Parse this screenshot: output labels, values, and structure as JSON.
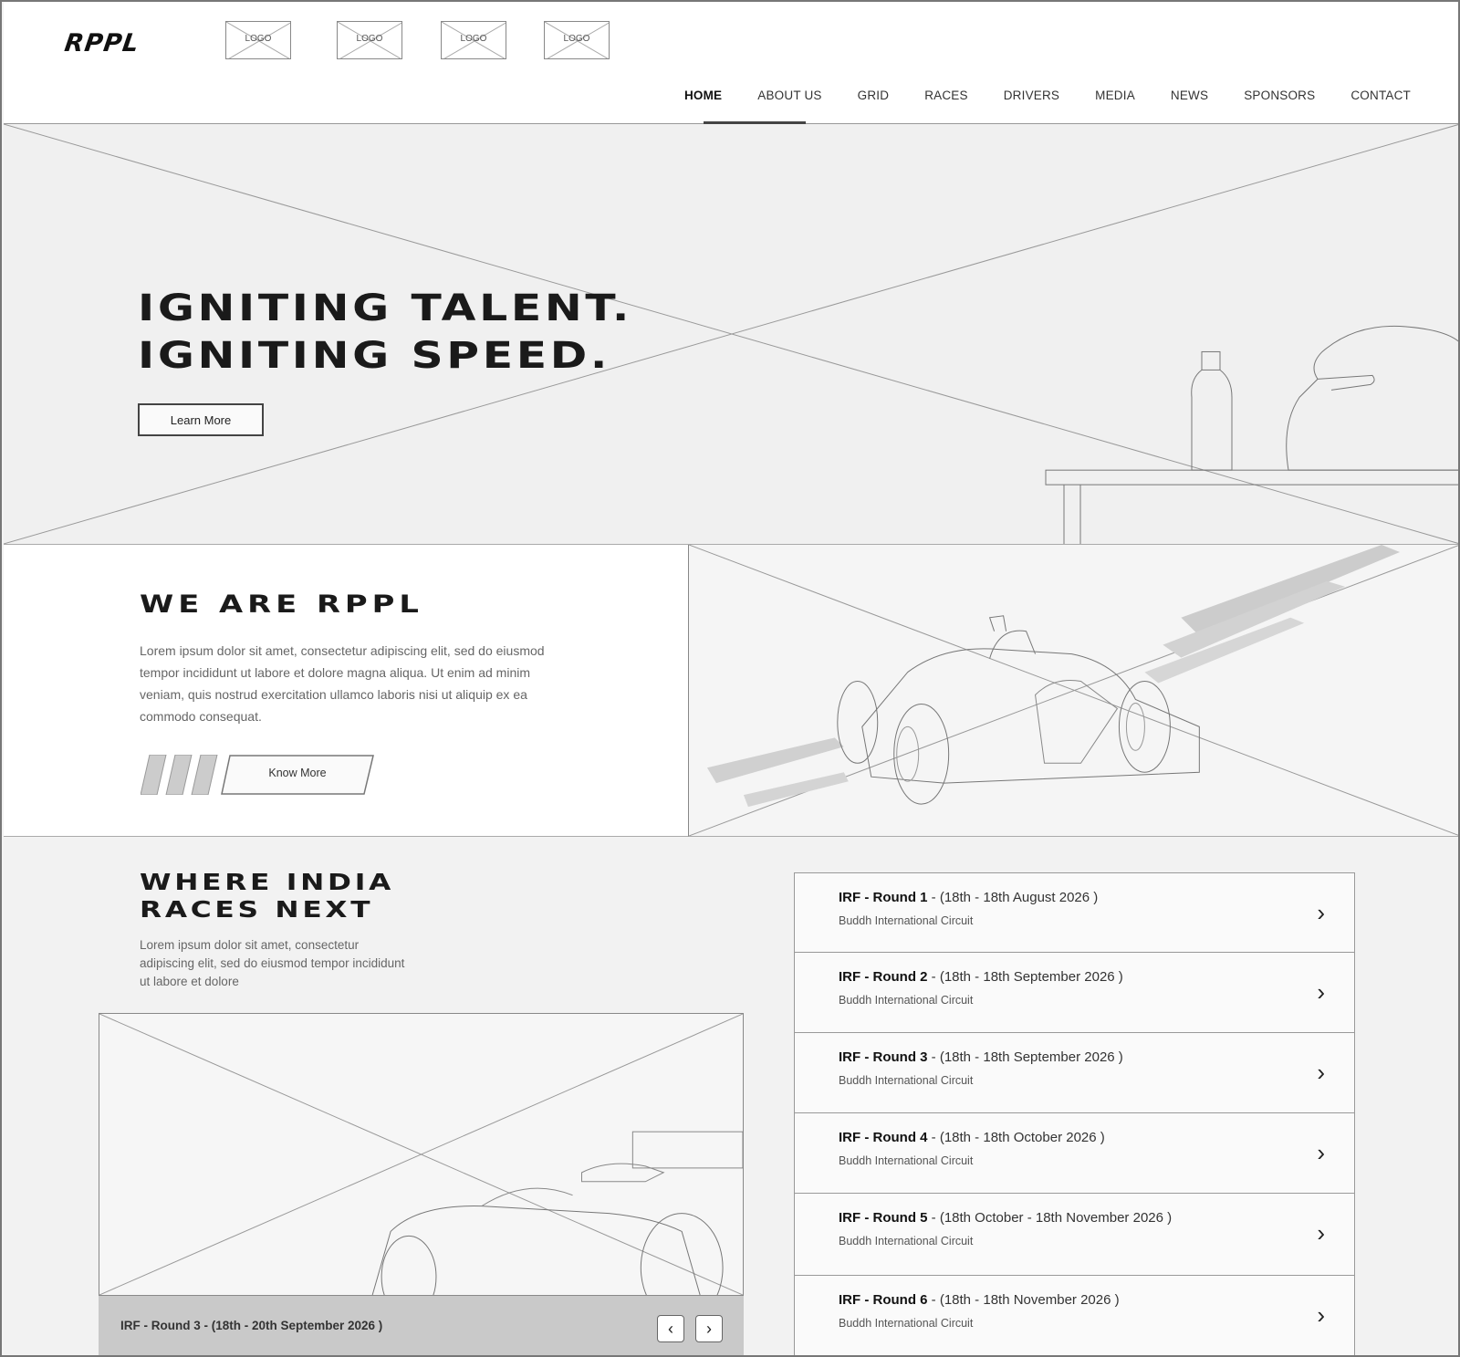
{
  "header": {
    "brand": "RPPL",
    "logos": [
      "LOGO",
      "LOGO",
      "LOGO",
      "LOGO"
    ],
    "nav": [
      "HOME",
      "ABOUT US",
      "GRID",
      "RACES",
      "DRIVERS",
      "MEDIA",
      "NEWS",
      "SPONSORS",
      "CONTACT"
    ],
    "active_nav": "HOME"
  },
  "hero": {
    "title_line1": "IGNITING TALENT.",
    "title_line2": "IGNITING SPEED.",
    "button": "Learn More"
  },
  "about": {
    "title": "WE ARE RPPL",
    "text": "Lorem ipsum dolor sit amet, consectetur adipiscing elit, sed do eiusmod tempor incididunt ut labore et dolore magna aliqua. Ut enim ad minim veniam, quis nostrud exercitation ullamco laboris nisi ut aliquip ex ea commodo consequat.",
    "button": "Know More"
  },
  "races": {
    "title_line1": "WHERE INDIA",
    "title_line2": "RACES NEXT",
    "text": "Lorem ipsum dolor sit amet, consectetur adipiscing elit, sed do eiusmod tempor incididunt ut labore et dolore",
    "slider_label": "IRF - Round 3 - (18th - 20th September 2026 )",
    "prev_icon": "chevron-left-icon",
    "next_icon": "chevron-right-icon",
    "items": [
      {
        "round": "IRF - Round 1",
        "dates": " - (18th - 18th August 2026 )",
        "venue": "Buddh International Circuit"
      },
      {
        "round": "IRF - Round 2",
        "dates": " - (18th - 18th September 2026 )",
        "venue": "Buddh International Circuit"
      },
      {
        "round": "IRF - Round 3",
        "dates": " - (18th - 18th September 2026 )",
        "venue": "Buddh International Circuit"
      },
      {
        "round": "IRF - Round 4",
        "dates": " - (18th - 18th October 2026 )",
        "venue": "Buddh International Circuit"
      },
      {
        "round": "IRF - Round 5",
        "dates": " - (18th October - 18th November 2026 )",
        "venue": "Buddh International Circuit"
      },
      {
        "round": "IRF - Round 6",
        "dates": " - (18th - 18th November 2026 )",
        "venue": "Buddh International Circuit"
      }
    ]
  }
}
